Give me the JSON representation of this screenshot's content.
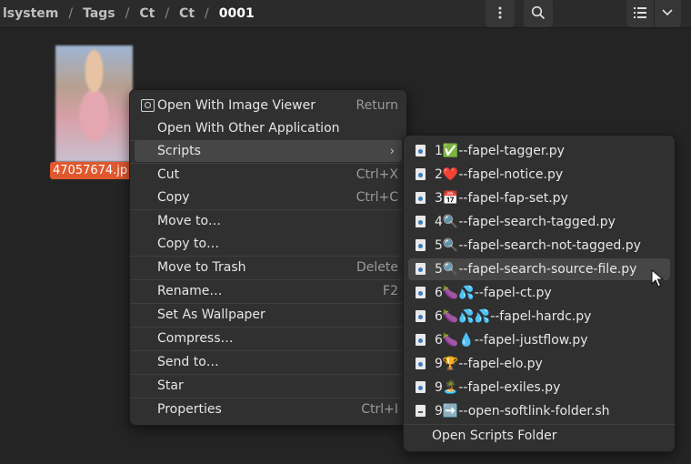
{
  "breadcrumb": [
    "lsystem",
    "Tags",
    "Ct",
    "Ct",
    "0001"
  ],
  "header": {
    "menu_icon": "kebab-menu-icon",
    "search_icon": "search-icon",
    "list_view_icon": "list-view-icon",
    "chevron_icon": "chevron-down-icon"
  },
  "file": {
    "name": "47057674.jp"
  },
  "context_menu": {
    "items": [
      {
        "label": "Open With Image Viewer",
        "shortcut": "Return"
      },
      {
        "label": "Open With Other Application",
        "shortcut": ""
      },
      {
        "label": "Scripts",
        "shortcut": ""
      },
      {
        "label": "Cut",
        "shortcut": "Ctrl+X"
      },
      {
        "label": "Copy",
        "shortcut": "Ctrl+C"
      },
      {
        "label": "Move to…",
        "shortcut": ""
      },
      {
        "label": "Copy to…",
        "shortcut": ""
      },
      {
        "label": "Move to Trash",
        "shortcut": "Delete"
      },
      {
        "label": "Rename…",
        "shortcut": "F2"
      },
      {
        "label": "Set As Wallpaper",
        "shortcut": ""
      },
      {
        "label": "Compress…",
        "shortcut": ""
      },
      {
        "label": "Send to…",
        "shortcut": ""
      },
      {
        "label": "Star",
        "shortcut": ""
      },
      {
        "label": "Properties",
        "shortcut": "Ctrl+I"
      }
    ]
  },
  "scripts_menu": {
    "items": [
      "1✅--fapel-tagger.py",
      "2❤️--fapel-notice.py",
      "3📅--fapel-fap-set.py",
      "4🔍--fapel-search-tagged.py",
      "5🔍--fapel-search-not-tagged.py",
      "5🔍--fapel-search-source-file.py",
      "6🍆💦--fapel-ct.py",
      "6🍆💦💦--fapel-hardc.py",
      "6🍆💧--fapel-justflow.py",
      "9🏆--fapel-elo.py",
      "9🏝️--fapel-exiles.py",
      "9➡️--open-softlink-folder.sh"
    ],
    "footer": "Open Scripts Folder"
  }
}
